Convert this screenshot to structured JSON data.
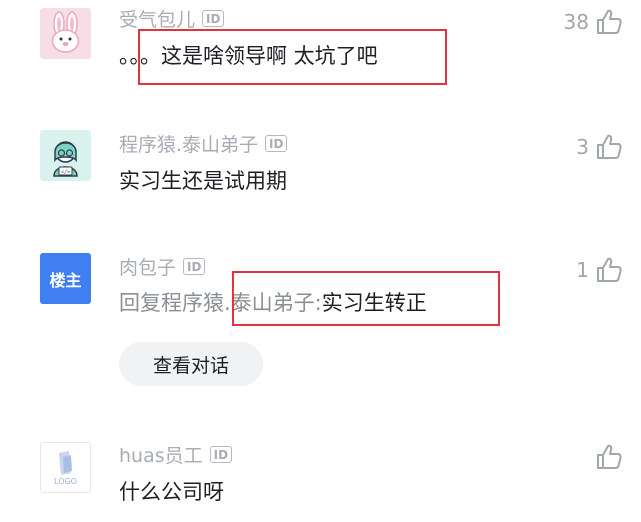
{
  "comments": [
    {
      "username": "受气包儿",
      "id_badge": "ID",
      "text": "。。。这是啥领导啊 太坑了吧",
      "likes": "38",
      "avatar": "bunny-avatar"
    },
    {
      "username": "程序猿.泰山弟子",
      "id_badge": "ID",
      "text": "实习生还是试用期",
      "likes": "3",
      "avatar": "coder-avatar"
    },
    {
      "username": "肉包子",
      "id_badge": "ID",
      "reply_prefix": "回复程序猿.泰山弟子:",
      "text": "实习生转正",
      "likes": "1",
      "avatar_badge": "楼主",
      "view_conversation": "查看对话"
    },
    {
      "username": "huas员工",
      "id_badge": "ID",
      "text": "什么公司呀",
      "likes": "",
      "avatar": "logo-avatar",
      "avatar_text": "LOGO"
    }
  ],
  "colors": {
    "highlight_box": "#e5333b",
    "op_badge_bg": "#3f7ff1",
    "username": "#a8adb5",
    "body_text": "#1c1f23"
  },
  "icons": [
    "thumbs-up-icon"
  ]
}
